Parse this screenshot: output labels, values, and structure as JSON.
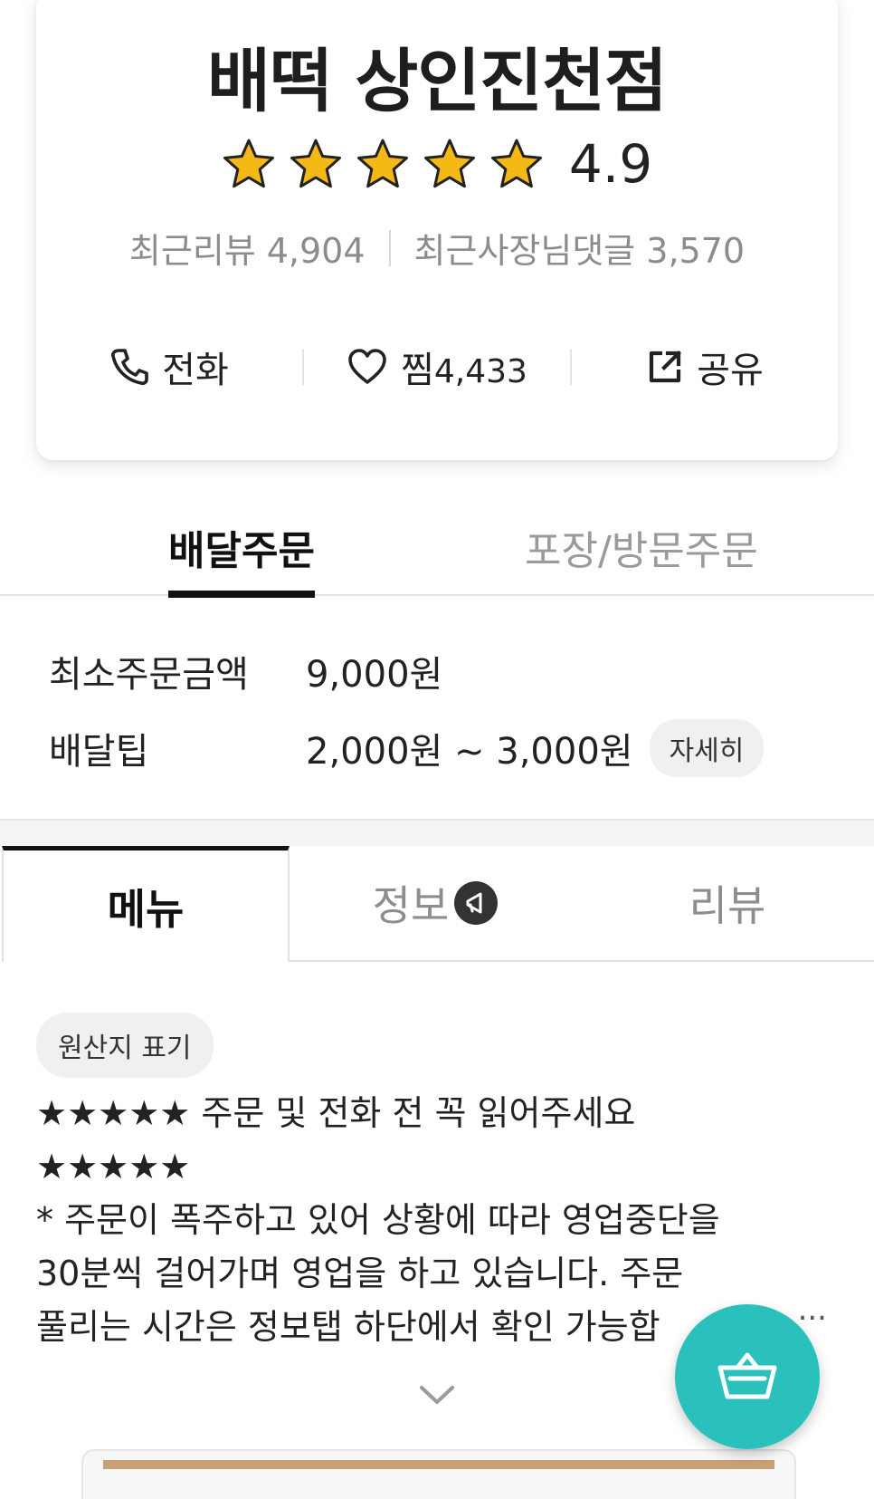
{
  "store": {
    "name": "배떡 상인진천점",
    "rating": "4.9",
    "stars_filled": 5,
    "stars_total": 5,
    "recent_reviews_label": "최근리뷰",
    "recent_reviews_count": "4,904",
    "owner_replies_label": "최근사장님댓글",
    "owner_replies_count": "3,570"
  },
  "actions": {
    "call_label": "전화",
    "like_label": "찜",
    "like_count": "4,433",
    "share_label": "공유"
  },
  "order_tabs": {
    "delivery": "배달주문",
    "pickup": "포장/방문주문",
    "active": "delivery"
  },
  "order_info": {
    "min_order_label": "최소주문금액",
    "min_order_value": "9,000원",
    "delivery_tip_label": "배달팁",
    "delivery_tip_value": "2,000원 ~ 3,000원",
    "detail_button": "자세히"
  },
  "main_tabs": {
    "menu": "메뉴",
    "info": "정보",
    "review": "리뷰",
    "active": "menu"
  },
  "origin_chip": "원산지 표기",
  "notice": {
    "line1": "★★★★★ 주문 및 전화 전 꼭 읽어주세요",
    "line2": "★★★★★",
    "line3": "* 주문이 폭주하고 있어 상황에 따라 영업중단을",
    "line4": "30분씩 걸어가며 영업을 하고 있습니다. 주문",
    "line5": "풀리는 시간은 정보탭 하단에서 확인 가능합",
    "ellipsis": "..."
  },
  "colors": {
    "accent_mint": "#2ac1bc",
    "star_gold": "#f5b915",
    "text_dark": "#222222",
    "text_gray": "#8c8c8c"
  },
  "icons": {
    "call": "phone-icon",
    "like": "heart-icon",
    "share": "share-external-icon",
    "info_badge": "megaphone-icon",
    "expand": "chevron-down-icon",
    "cart": "basket-icon"
  }
}
